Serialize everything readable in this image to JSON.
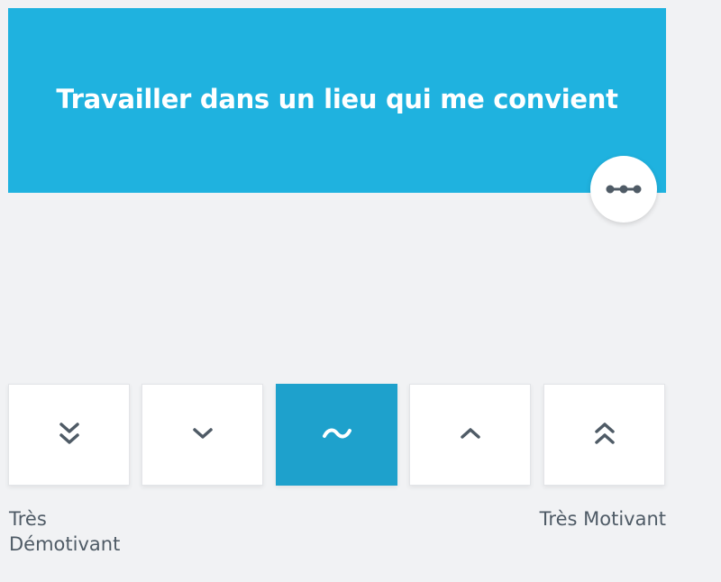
{
  "card": {
    "title": "Travailler dans un lieu qui me convient",
    "color": "#1fb2df"
  },
  "more_button": {
    "icon": "more-options-icon"
  },
  "scale": {
    "options": [
      {
        "icon": "double-chevron-down-icon"
      },
      {
        "icon": "chevron-down-icon"
      },
      {
        "icon": "tilde-icon",
        "selected": true
      },
      {
        "icon": "chevron-up-icon"
      },
      {
        "icon": "double-chevron-up-icon"
      }
    ],
    "selected_index": 2,
    "selected_color": "#1ea1cc",
    "label_min": "Très Démotivant",
    "label_max": "Très Motivant"
  }
}
